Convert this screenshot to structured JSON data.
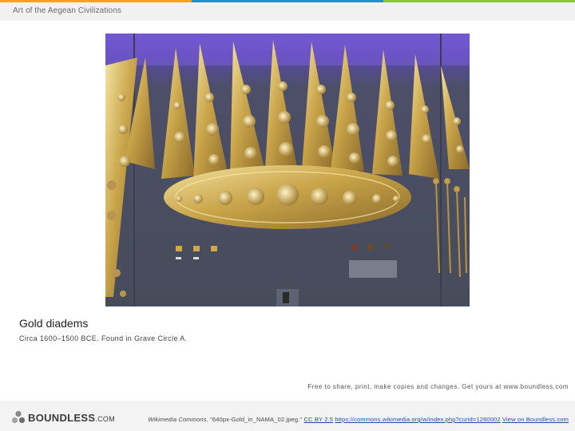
{
  "header": {
    "title": "Art of the Aegean Civilizations",
    "accent_colors": [
      "#f2a31b",
      "#2a8fc7",
      "#8dc63f"
    ]
  },
  "figure": {
    "image_icon": "gold-diadems-photo",
    "caption_title": "Gold diadems",
    "caption_text": "Circa 1600–1500 BCE. Found in Grave Circle A."
  },
  "footer": {
    "logo_text": "BOUNDLESS",
    "logo_suffix": ".COM",
    "notice": "Free to share, print, make copies and changes. Get yours at www.boundless.com",
    "attribution": {
      "source": "Wikimedia Commons.",
      "filename": " \"640px-Gold_in_NAMA_02.jpeg.\" ",
      "license_link": "CC BY 2.5",
      "url_link": "https://commons.wikimedia.org/w/index.php?curid=1260002",
      "view_link": "View on Boundless.com"
    }
  }
}
